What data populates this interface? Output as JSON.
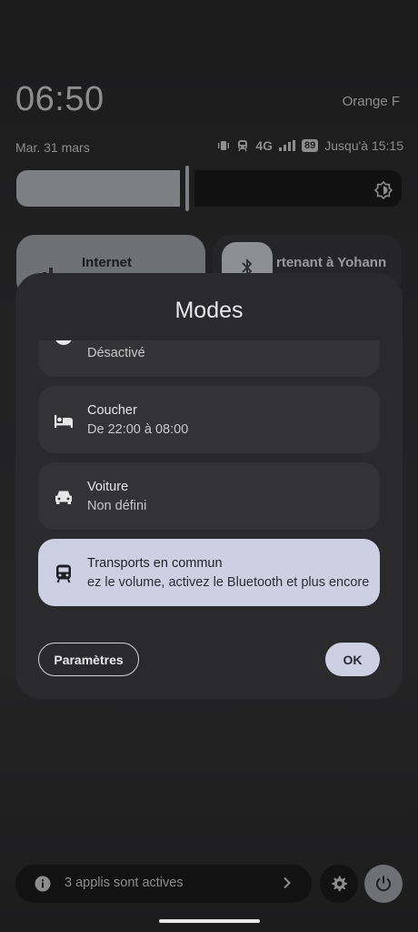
{
  "status_bar": {
    "time": "06:50",
    "carrier": "Orange F",
    "date": "Mar. 31 mars",
    "network": "4G",
    "battery": "89",
    "dnd_until": "Jusqu'à 15:15"
  },
  "quick_tiles": {
    "internet_label": "Internet",
    "bluetooth_label": "rtenant à Yohann"
  },
  "brightness": {
    "level": 0.45
  },
  "modal": {
    "title": "Modes",
    "modes": [
      {
        "name": "",
        "status": "Désactivé",
        "icon": "moon-face-icon"
      },
      {
        "name": "Coucher",
        "status": "De 22:00 à 08:00",
        "icon": "bed-icon"
      },
      {
        "name": "Voiture",
        "status": "Non défini",
        "icon": "car-icon"
      },
      {
        "name": "Transports en commun",
        "status": "ez le volume, activez le Bluetooth et plus encore",
        "icon": "train-icon",
        "active": true
      }
    ],
    "settings_button": "Paramètres",
    "ok_button": "OK"
  },
  "footer": {
    "active_apps": "3 applis sont actives"
  },
  "colors": {
    "accent": "#ccd0e2",
    "card": "#333335",
    "modal": "#2a2a2c"
  }
}
